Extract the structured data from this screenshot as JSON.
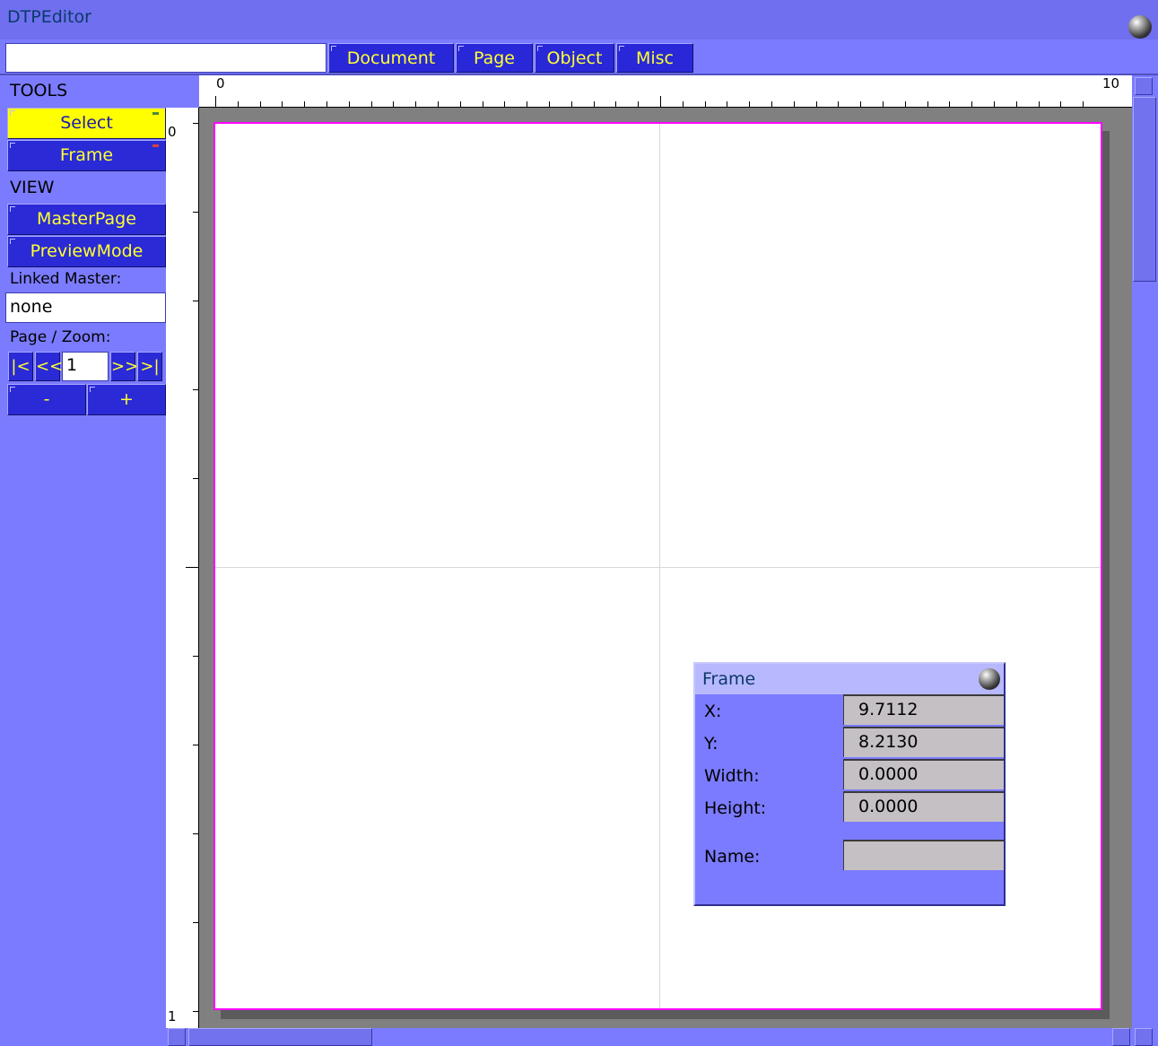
{
  "window": {
    "title": "DTPEditor"
  },
  "menu": {
    "input_value": "",
    "items": [
      "Document",
      "Page",
      "Object",
      "Misc"
    ]
  },
  "sidebar": {
    "tools_heading": "TOOLS",
    "tools": [
      "Select",
      "Frame"
    ],
    "view_heading": "VIEW",
    "view_buttons": [
      "MasterPage",
      "PreviewMode"
    ],
    "linked_master_label": "Linked Master:",
    "linked_master_value": "none",
    "page_zoom_label": "Page / Zoom:",
    "nav": {
      "first": "|<",
      "prev": "<<",
      "page": "1",
      "next": ">>",
      "last": ">|"
    },
    "zoom_out": "-",
    "zoom_in": "+"
  },
  "rulers": {
    "top_start": "0",
    "top_end": "10",
    "left_start": "0",
    "left_end": "1"
  },
  "frame_dialog": {
    "title": "Frame",
    "x_label": "X:",
    "x_value": "9.7112",
    "y_label": "Y:",
    "y_value": "8.2130",
    "width_label": "Width:",
    "width_value": "0.0000",
    "height_label": "Height:",
    "height_value": "0.0000",
    "name_label": "Name:",
    "name_value": ""
  },
  "colors": {
    "background": "#7b7bff",
    "button": "#2a2ad6",
    "button_text": "#ffff33",
    "active_tool": "#ffff00",
    "page_border": "#ff00ff"
  }
}
